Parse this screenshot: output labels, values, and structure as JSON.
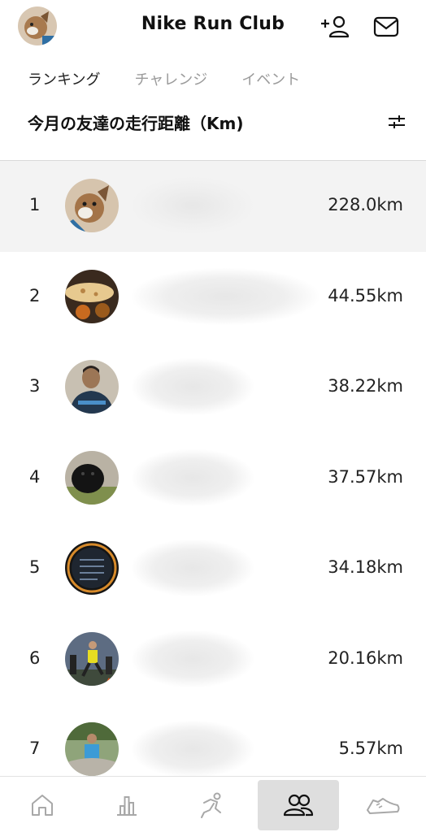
{
  "header": {
    "title": "Nike Run Club",
    "add_friend_icon": "add-friend-icon",
    "inbox_icon": "mail-icon"
  },
  "tabs": [
    {
      "label": "ランキング",
      "active": true
    },
    {
      "label": "チャレンジ",
      "active": false
    },
    {
      "label": "イベント",
      "active": false
    }
  ],
  "section": {
    "title": "今月の友達の走行距離（Km)",
    "filter_icon": "filter-sliders-icon"
  },
  "leaderboard": [
    {
      "rank": "1",
      "distance": "228.0km",
      "highlighted": true,
      "avatar": "dog-avatar"
    },
    {
      "rank": "2",
      "distance": "44.55km",
      "highlighted": false,
      "avatar": "food-avatar"
    },
    {
      "rank": "3",
      "distance": "38.22km",
      "highlighted": false,
      "avatar": "person-avatar"
    },
    {
      "rank": "4",
      "distance": "37.57km",
      "highlighted": false,
      "avatar": "black-dog-avatar"
    },
    {
      "rank": "5",
      "distance": "34.18km",
      "highlighted": false,
      "avatar": "watch-avatar"
    },
    {
      "rank": "6",
      "distance": "20.16km",
      "highlighted": false,
      "avatar": "runner-avatar"
    },
    {
      "rank": "7",
      "distance": "5.57km",
      "highlighted": false,
      "avatar": "outdoor-person-avatar"
    }
  ],
  "tabbar": [
    {
      "icon": "home-icon",
      "selected": false
    },
    {
      "icon": "activity-chart-icon",
      "selected": false
    },
    {
      "icon": "run-icon",
      "selected": false
    },
    {
      "icon": "friends-icon",
      "selected": true
    },
    {
      "icon": "shoe-icon",
      "selected": false
    }
  ],
  "colors": {
    "text": "#222222",
    "inactive_tab": "#9b9b9b",
    "highlight_row": "#f3f3f3",
    "selected_tab": "#dedede"
  }
}
